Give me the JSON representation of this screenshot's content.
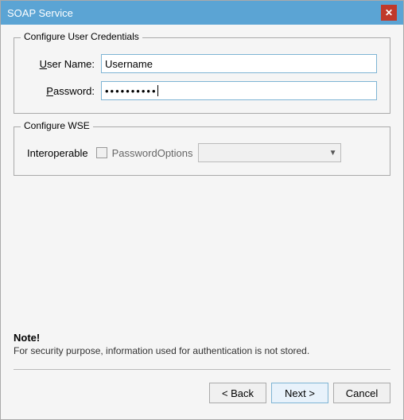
{
  "window": {
    "title": "SOAP Service",
    "close_label": "✕"
  },
  "credentials_section": {
    "legend": "Configure User Credentials",
    "username_label": "User Name:",
    "username_underline": "U",
    "username_value": "Username",
    "password_label": "Password:",
    "password_underline": "P",
    "password_dots": "••••••••••"
  },
  "wse_section": {
    "legend": "Configure WSE",
    "interoperable_label": "Interoperable",
    "password_options_label": "PasswordOptions"
  },
  "note": {
    "title": "Note!",
    "text": "For security purpose, information used for authentication is not stored."
  },
  "buttons": {
    "back_label": "< Back",
    "next_label": "Next >",
    "cancel_label": "Cancel"
  }
}
